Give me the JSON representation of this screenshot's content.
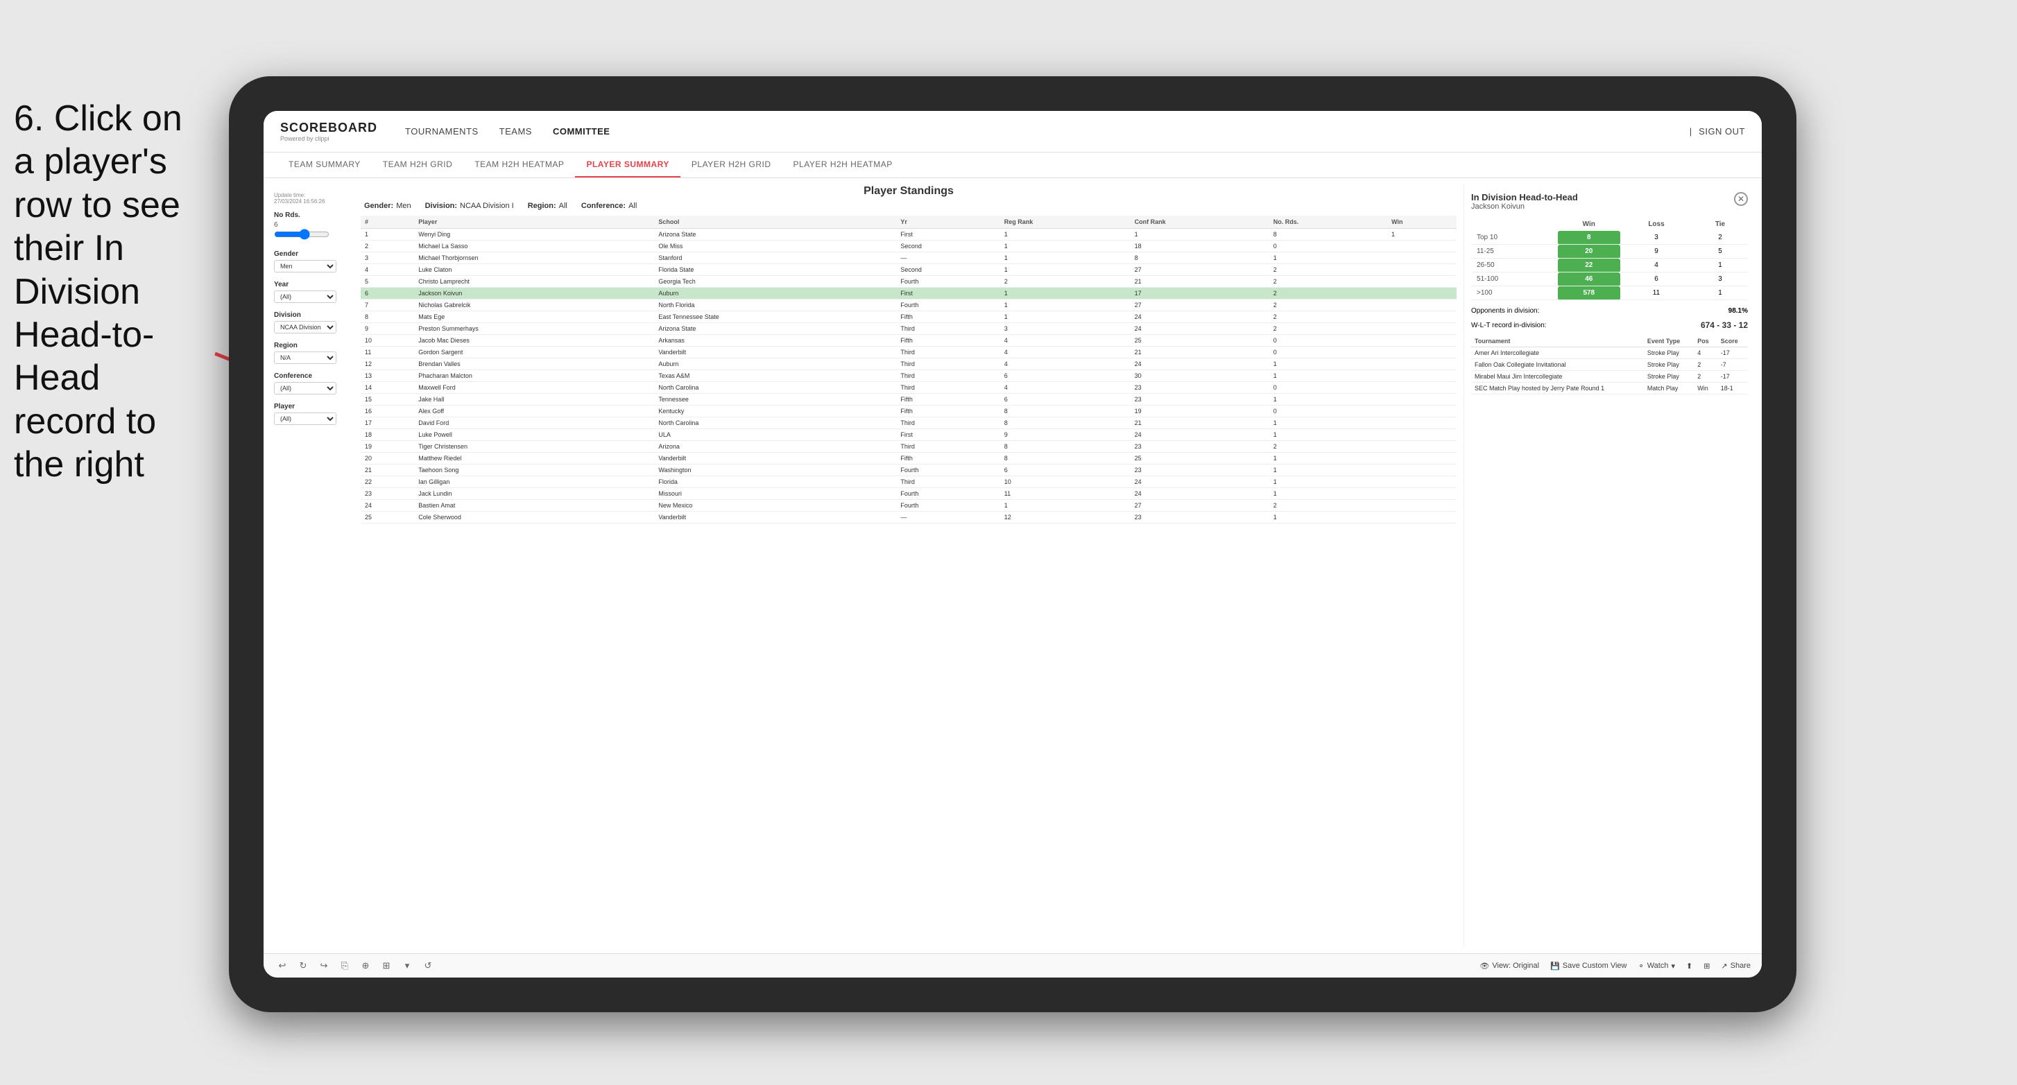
{
  "instruction": {
    "text": "6. Click on a player's row to see their In Division Head-to-Head record to the right"
  },
  "nav": {
    "logo": "SCOREBOARD",
    "powered_by": "Powered by clippi",
    "items": [
      "TOURNAMENTS",
      "TEAMS",
      "COMMITTEE"
    ],
    "sign_out": "Sign out"
  },
  "sub_nav": {
    "items": [
      "TEAM SUMMARY",
      "TEAM H2H GRID",
      "TEAM H2H HEATMAP",
      "PLAYER SUMMARY",
      "PLAYER H2H GRID",
      "PLAYER H2H HEATMAP"
    ],
    "active": "PLAYER SUMMARY"
  },
  "sidebar": {
    "update_time_label": "Update time:",
    "update_time": "27/03/2024 16:56:26",
    "no_rds_label": "No Rds.",
    "no_rds_value": "6",
    "gender_label": "Gender",
    "gender_value": "Men",
    "year_label": "Year",
    "year_value": "(All)",
    "division_label": "Division",
    "division_value": "NCAA Division I",
    "region_label": "Region",
    "region_value": "N/A",
    "conference_label": "Conference",
    "conference_value": "(All)",
    "player_label": "Player",
    "player_value": "(All)"
  },
  "standings": {
    "title": "Player Standings",
    "gender_label": "Gender:",
    "gender_value": "Men",
    "division_label": "Division:",
    "division_value": "NCAA Division I",
    "region_label": "Region:",
    "region_value": "All",
    "conference_label": "Conference:",
    "conference_value": "All",
    "columns": [
      "#",
      "Player",
      "School",
      "Yr",
      "Reg Rank",
      "Conf Rank",
      "No. Rds.",
      "Win"
    ],
    "players": [
      {
        "rank": 1,
        "name": "Wenyi Ding",
        "school": "Arizona State",
        "yr": "First",
        "reg": 1,
        "conf": 1,
        "rds": 8,
        "win": 1
      },
      {
        "rank": 2,
        "name": "Michael La Sasso",
        "school": "Ole Miss",
        "yr": "Second",
        "reg": 1,
        "conf": 18,
        "rds": 0
      },
      {
        "rank": 3,
        "name": "Michael Thorbjornsen",
        "school": "Stanford",
        "yr": "—",
        "reg": 1,
        "conf": 8,
        "rds": 1
      },
      {
        "rank": 4,
        "name": "Luke Claton",
        "school": "Florida State",
        "yr": "Second",
        "reg": 1,
        "conf": 27,
        "rds": 2
      },
      {
        "rank": 5,
        "name": "Christo Lamprecht",
        "school": "Georgia Tech",
        "yr": "Fourth",
        "reg": 2,
        "conf": 21,
        "rds": 2
      },
      {
        "rank": 6,
        "name": "Jackson Koivun",
        "school": "Auburn",
        "yr": "First",
        "reg": 1,
        "conf": 17,
        "rds": 2
      },
      {
        "rank": 7,
        "name": "Nicholas Gabrelcik",
        "school": "North Florida",
        "yr": "Fourth",
        "reg": 1,
        "conf": 27,
        "rds": 2
      },
      {
        "rank": 8,
        "name": "Mats Ege",
        "school": "East Tennessee State",
        "yr": "Fifth",
        "reg": 1,
        "conf": 24,
        "rds": 2
      },
      {
        "rank": 9,
        "name": "Preston Summerhays",
        "school": "Arizona State",
        "yr": "Third",
        "reg": 3,
        "conf": 24,
        "rds": 2
      },
      {
        "rank": 10,
        "name": "Jacob Mac Dieses",
        "school": "Arkansas",
        "yr": "Fifth",
        "reg": 4,
        "conf": 25,
        "rds": 0
      },
      {
        "rank": 11,
        "name": "Gordon Sargent",
        "school": "Vanderbilt",
        "yr": "Third",
        "reg": 4,
        "conf": 21,
        "rds": 0
      },
      {
        "rank": 12,
        "name": "Brendan Valles",
        "school": "Auburn",
        "yr": "Third",
        "reg": 4,
        "conf": 24,
        "rds": 1
      },
      {
        "rank": 13,
        "name": "Phacharan Malcton",
        "school": "Texas A&M",
        "yr": "Third",
        "reg": 6,
        "conf": 30,
        "rds": 1
      },
      {
        "rank": 14,
        "name": "Maxwell Ford",
        "school": "North Carolina",
        "yr": "Third",
        "reg": 4,
        "conf": 23,
        "rds": 0
      },
      {
        "rank": 15,
        "name": "Jake Hall",
        "school": "Tennessee",
        "yr": "Fifth",
        "reg": 6,
        "conf": 23,
        "rds": 1
      },
      {
        "rank": 16,
        "name": "Alex Goff",
        "school": "Kentucky",
        "yr": "Fifth",
        "reg": 8,
        "conf": 19,
        "rds": 0
      },
      {
        "rank": 17,
        "name": "David Ford",
        "school": "North Carolina",
        "yr": "Third",
        "reg": 8,
        "conf": 21,
        "rds": 1
      },
      {
        "rank": 18,
        "name": "Luke Powell",
        "school": "ULA",
        "yr": "First",
        "reg": 9,
        "conf": 24,
        "rds": 1
      },
      {
        "rank": 19,
        "name": "Tiger Christensen",
        "school": "Arizona",
        "yr": "Third",
        "reg": 8,
        "conf": 23,
        "rds": 2
      },
      {
        "rank": 20,
        "name": "Matthew Riedel",
        "school": "Vanderbilt",
        "yr": "Fifth",
        "reg": 8,
        "conf": 25,
        "rds": 1
      },
      {
        "rank": 21,
        "name": "Taehoon Song",
        "school": "Washington",
        "yr": "Fourth",
        "reg": 6,
        "conf": 23,
        "rds": 1
      },
      {
        "rank": 22,
        "name": "Ian Gilligan",
        "school": "Florida",
        "yr": "Third",
        "reg": 10,
        "conf": 24,
        "rds": 1
      },
      {
        "rank": 23,
        "name": "Jack Lundin",
        "school": "Missouri",
        "yr": "Fourth",
        "reg": 11,
        "conf": 24,
        "rds": 1
      },
      {
        "rank": 24,
        "name": "Bastien Amat",
        "school": "New Mexico",
        "yr": "Fourth",
        "reg": 1,
        "conf": 27,
        "rds": 2
      },
      {
        "rank": 25,
        "name": "Cole Sherwood",
        "school": "Vanderbilt",
        "yr": "—",
        "reg": 12,
        "conf": 23,
        "rds": 1
      }
    ]
  },
  "h2h": {
    "title": "In Division Head-to-Head",
    "player_name": "Jackson Koivun",
    "columns": [
      "",
      "Win",
      "Loss",
      "Tie"
    ],
    "rows": [
      {
        "label": "Top 10",
        "win": 8,
        "loss": 3,
        "tie": 2
      },
      {
        "label": "11-25",
        "win": 20,
        "loss": 9,
        "tie": 5
      },
      {
        "label": "26-50",
        "win": 22,
        "loss": 4,
        "tie": 1
      },
      {
        "label": "51-100",
        "win": 46,
        "loss": 6,
        "tie": 3
      },
      {
        "label": ">100",
        "win": 578,
        "loss": 11,
        "tie": 1
      }
    ],
    "opponents_label": "Opponents in division:",
    "opponents_value": "98.1%",
    "record_label": "W-L-T record in-division:",
    "record_value": "674 - 33 - 12",
    "tournaments": {
      "columns": [
        "Tournament",
        "Event Type",
        "Pos",
        "Score"
      ],
      "rows": [
        {
          "tournament": "Amer Ari Intercollegiate",
          "event_type": "Stroke Play",
          "pos": 4,
          "score": "-17"
        },
        {
          "tournament": "Fallon Oak Collegiate Invitational",
          "event_type": "Stroke Play",
          "pos": 2,
          "score": "-7"
        },
        {
          "tournament": "Mirabel Maui Jim Intercollegiate",
          "event_type": "Stroke Play",
          "pos": 2,
          "score": "-17"
        },
        {
          "tournament": "SEC Match Play hosted by Jerry Pate Round 1",
          "event_type": "Match Play",
          "pos": "Win",
          "score": "18-1"
        }
      ]
    }
  },
  "toolbar": {
    "view_original": "View: Original",
    "save_custom": "Save Custom View",
    "watch": "Watch",
    "share": "Share"
  }
}
